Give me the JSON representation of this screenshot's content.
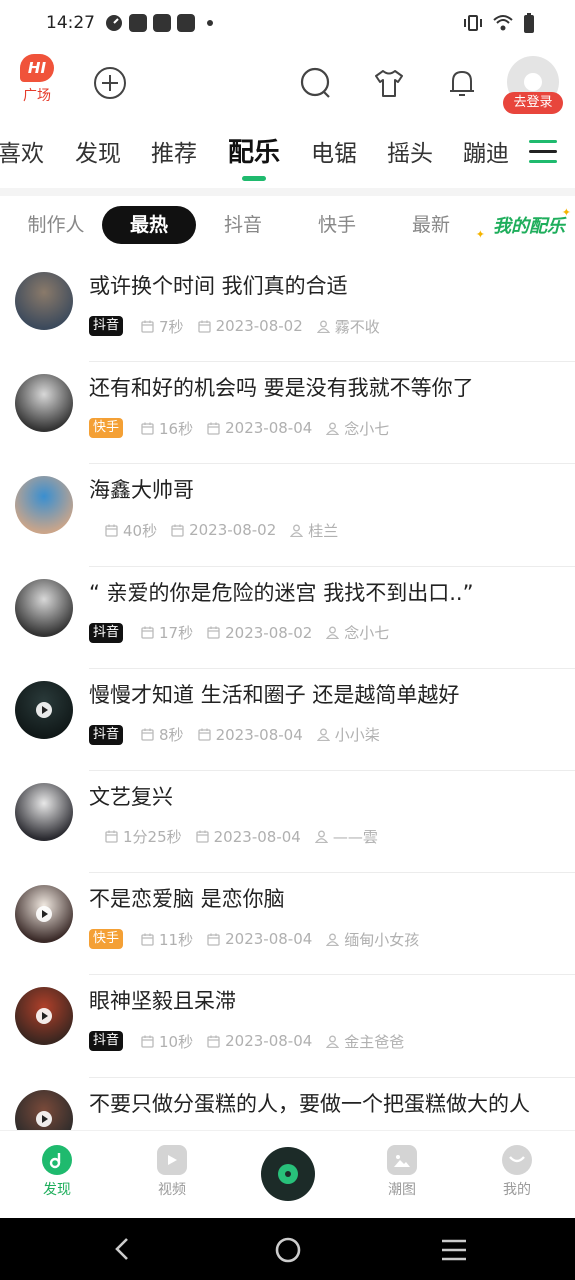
{
  "status_bar": {
    "time": "14:27"
  },
  "header": {
    "square_badge": "HI",
    "square_label": "广场",
    "login_label": "去登录"
  },
  "category_tabs": [
    "喜欢",
    "发现",
    "推荐",
    "配乐",
    "电锯",
    "摇头",
    "蹦迪"
  ],
  "active_category": "配乐",
  "sub_tabs": [
    "制作人",
    "最热",
    "抖音",
    "快手",
    "最新"
  ],
  "active_sub_tab": "最热",
  "my_peiyue": "我的配乐",
  "items": [
    {
      "title": "或许换个时间 我们真的合适",
      "source": "抖音",
      "source_type": "douyin",
      "duration": "7秒",
      "date": "2023-08-02",
      "author": "霧不收",
      "has_play": false,
      "thumb": [
        "#8a7a6a",
        "#3c4a5c"
      ]
    },
    {
      "title": "还有和好的机会吗 要是没有我就不等你了",
      "source": "快手",
      "source_type": "kuaishou",
      "duration": "16秒",
      "date": "2023-08-04",
      "author": "念小七",
      "has_play": false,
      "thumb": [
        "#d8d8d8",
        "#333333"
      ]
    },
    {
      "title": "海鑫大帅哥",
      "source": "",
      "source_type": "none",
      "duration": "40秒",
      "date": "2023-08-02",
      "author": "桂兰",
      "has_play": false,
      "thumb": [
        "#3a8fd0",
        "#caa58a"
      ]
    },
    {
      "title": "“ 亲爱的你是危险的迷宫 我找不到出口..”",
      "source": "抖音",
      "source_type": "douyin",
      "duration": "17秒",
      "date": "2023-08-02",
      "author": "念小七",
      "has_play": false,
      "thumb": [
        "#d8d8d8",
        "#333333"
      ]
    },
    {
      "title": "慢慢才知道 生活和圈子 还是越简单越好",
      "source": "抖音",
      "source_type": "douyin",
      "duration": "8秒",
      "date": "2023-08-04",
      "author": "小小柒",
      "has_play": true,
      "thumb": [
        "#2a3a3a",
        "#101818"
      ]
    },
    {
      "title": "文艺复兴",
      "source": "",
      "source_type": "none",
      "duration": "1分25秒",
      "date": "2023-08-04",
      "author": "——雲",
      "has_play": false,
      "thumb": [
        "#e8e8e8",
        "#2a2a30"
      ]
    },
    {
      "title": "不是恋爱脑 是恋你脑",
      "source": "快手",
      "source_type": "kuaishou",
      "duration": "11秒",
      "date": "2023-08-04",
      "author": "缅甸小女孩",
      "has_play": true,
      "thumb": [
        "#f0e8e0",
        "#3a2a28"
      ]
    },
    {
      "title": "眼神坚毅且呆滞",
      "source": "抖音",
      "source_type": "douyin",
      "duration": "10秒",
      "date": "2023-08-04",
      "author": "金主爸爸",
      "has_play": true,
      "thumb": [
        "#b0402a",
        "#3a2620"
      ]
    },
    {
      "title": "不要只做分蛋糕的人，要做一个把蛋糕做大的人",
      "source": "",
      "source_type": "none",
      "duration": "",
      "date": "",
      "author": "",
      "has_play": true,
      "thumb": [
        "#7a4a3a",
        "#2a2a2a"
      ]
    }
  ],
  "bottom_nav": [
    {
      "label": "发现",
      "active": true
    },
    {
      "label": "视频",
      "active": false
    },
    {
      "label": "潮图",
      "active": false
    },
    {
      "label": "我的",
      "active": false
    }
  ],
  "colors": {
    "accent": "#1fba6e",
    "login_red": "#e8453c",
    "kuaishou": "#f4a035"
  }
}
